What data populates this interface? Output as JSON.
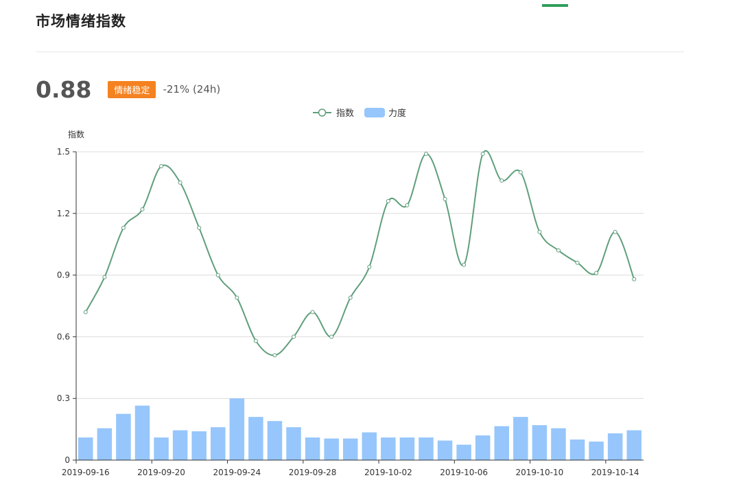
{
  "header": {
    "title": "市场情绪指数"
  },
  "summary": {
    "value": "0.88",
    "badge": "情绪稳定",
    "change": "-21% (24h)"
  },
  "colors": {
    "line": "#5f9e7b",
    "bar": "#96c6fb",
    "badge": "#f58220",
    "accent": "#2e9e5b"
  },
  "chart_data": {
    "type": "line",
    "ylabel": "指数",
    "ylim": [
      0,
      1.5
    ],
    "yticks": [
      "0",
      "0.3",
      "0.6",
      "0.9",
      "1.2",
      "1.5"
    ],
    "x": [
      "2019-09-16",
      "2019-09-17",
      "2019-09-18",
      "2019-09-19",
      "2019-09-20",
      "2019-09-21",
      "2019-09-22",
      "2019-09-23",
      "2019-09-24",
      "2019-09-25",
      "2019-09-26",
      "2019-09-27",
      "2019-09-28",
      "2019-09-29",
      "2019-09-30",
      "2019-10-01",
      "2019-10-02",
      "2019-10-03",
      "2019-10-04",
      "2019-10-05",
      "2019-10-06",
      "2019-10-07",
      "2019-10-08",
      "2019-10-09",
      "2019-10-10",
      "2019-10-11",
      "2019-10-12",
      "2019-10-13",
      "2019-10-14",
      "2019-10-15"
    ],
    "xtick_labels": [
      "2019-09-16",
      "2019-09-20",
      "2019-09-24",
      "2019-09-28",
      "2019-10-02",
      "2019-10-06",
      "2019-10-10",
      "2019-10-14"
    ],
    "legend": [
      "指数",
      "力度"
    ],
    "legend_position": "top-center",
    "grid": true,
    "series": [
      {
        "name": "指数",
        "type": "line",
        "smooth": true,
        "values": [
          0.72,
          0.89,
          1.13,
          1.22,
          1.43,
          1.35,
          1.13,
          0.9,
          0.79,
          0.58,
          0.51,
          0.6,
          0.72,
          0.6,
          0.79,
          0.94,
          1.26,
          1.24,
          1.49,
          1.27,
          0.95,
          1.49,
          1.36,
          1.4,
          1.11,
          1.02,
          0.96,
          0.91,
          1.11,
          0.88
        ]
      },
      {
        "name": "力度",
        "type": "bar",
        "values": [
          0.11,
          0.155,
          0.225,
          0.265,
          0.11,
          0.145,
          0.14,
          0.16,
          0.3,
          0.21,
          0.19,
          0.16,
          0.11,
          0.105,
          0.105,
          0.135,
          0.11,
          0.11,
          0.11,
          0.095,
          0.075,
          0.12,
          0.165,
          0.21,
          0.17,
          0.155,
          0.1,
          0.09,
          0.13,
          0.145
        ]
      }
    ]
  }
}
